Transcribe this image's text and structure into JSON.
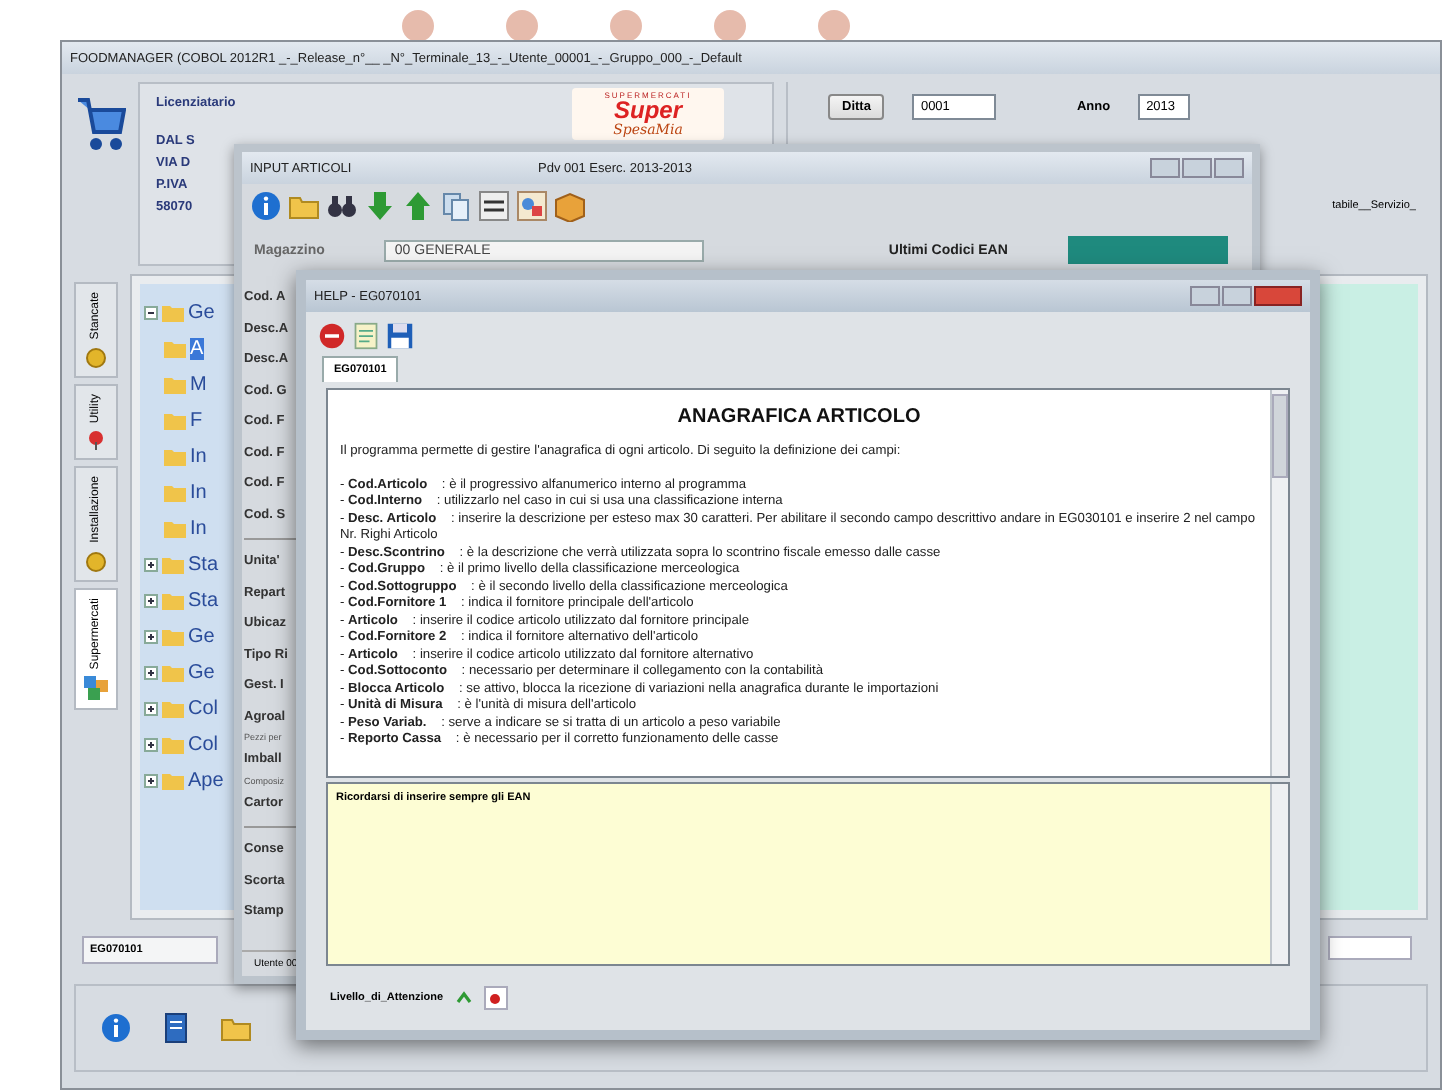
{
  "main_window": {
    "title": "FOODMANAGER (COBOL 2012R1 _-_Release_n°__ _N°_Terminale_13_-_Utente_00001_-_Gruppo_000_-_Default",
    "licensee": {
      "label": "Licenziatario",
      "lines": [
        "DAL S",
        "VIA D",
        "P.IVA",
        "58070"
      ]
    },
    "logo": {
      "tagline": "SUPERMERCATI",
      "word1": "Super",
      "word2": "SpesaMia"
    },
    "company_button": "Ditta",
    "company": "0001",
    "year_label": "Anno",
    "year": "2013",
    "right_label": "tabile__Servizio_",
    "side_tabs": [
      {
        "label": "Stancate",
        "selected": false
      },
      {
        "label": "Utility",
        "selected": false
      },
      {
        "label": "Installazione",
        "selected": false
      },
      {
        "label": "Supermercati",
        "selected": true
      }
    ],
    "tree": [
      {
        "label": "Ge",
        "expanded": true,
        "selected": false,
        "children": [
          {
            "label": "A",
            "selected": true
          },
          {
            "label": "M",
            "selected": false
          },
          {
            "label": "F",
            "selected": false
          },
          {
            "label": "In",
            "selected": false
          },
          {
            "label": "In",
            "selected": false
          },
          {
            "label": "In",
            "selected": false
          }
        ]
      },
      {
        "label": "Sta",
        "expanded": false,
        "selected": false
      },
      {
        "label": "Sta",
        "expanded": false,
        "selected": false
      },
      {
        "label": "Ge",
        "expanded": false,
        "selected": false
      },
      {
        "label": "Ge",
        "expanded": false,
        "selected": false
      },
      {
        "label": "Col",
        "expanded": false,
        "selected": false
      },
      {
        "label": "Col",
        "expanded": false,
        "selected": false
      },
      {
        "label": "Ape",
        "expanded": false,
        "selected": false
      }
    ],
    "program_code": "EG070101"
  },
  "input_window": {
    "title": "INPUT ARTICOLI",
    "info": "Pdv 001   Eserc. 2013-2013",
    "warehouse_label": "Magazzino",
    "warehouse": "00 GENERALE",
    "ean_label": "Ultimi Codici EAN",
    "field_groups": [
      [
        {
          "kind": "field",
          "label": "Cod. A"
        },
        {
          "kind": "field",
          "label": "Desc.A"
        },
        {
          "kind": "field",
          "label": "Desc.A"
        },
        {
          "kind": "field",
          "label": "Cod. G"
        },
        {
          "kind": "field",
          "label": "Cod. F"
        },
        {
          "kind": "field",
          "label": "Cod. F"
        },
        {
          "kind": "field",
          "label": "Cod. F"
        },
        {
          "kind": "field",
          "label": "Cod. S"
        }
      ],
      [
        {
          "kind": "field",
          "label": "Unita'"
        },
        {
          "kind": "field",
          "label": "Repart"
        },
        {
          "kind": "field",
          "label": "Ubicaz"
        },
        {
          "kind": "field",
          "label": "Tipo Ri"
        },
        {
          "kind": "field",
          "label": "Gest. I"
        },
        {
          "kind": "field",
          "label": "Agroal"
        },
        {
          "kind": "note",
          "label": "Pezzi per"
        },
        {
          "kind": "field",
          "label": "Imball"
        },
        {
          "kind": "note",
          "label": "Composiz"
        },
        {
          "kind": "field",
          "label": "Cartor"
        }
      ],
      [
        {
          "kind": "field",
          "label": "Conse"
        },
        {
          "kind": "field",
          "label": "Scorta"
        },
        {
          "kind": "field",
          "label": "Stamp"
        }
      ]
    ],
    "status": "Utente 00"
  },
  "help_window": {
    "title": "HELP - EG070101",
    "tabs": [
      {
        "label": "EG070101",
        "selected": true
      }
    ],
    "heading": "ANAGRAFICA ARTICOLO",
    "intro": "Il programma permette di gestire l'anagrafica di ogni articolo. Di seguito la definizione dei campi:",
    "items": [
      "- **Cod.Articolo**    : è il progressivo alfanumerico interno al programma",
      "- **Cod.Interno**    : utilizzarlo nel caso in cui si usa una classificazione interna",
      "- **Desc. Articolo**    : inserire la descrizione per esteso max 30 caratteri. Per abilitare il secondo campo descrittivo andare in EG030101 e inserire 2 nel campo Nr. Righi Articolo",
      "- **Desc.Scontrino**    : è la descrizione che verrà utilizzata sopra lo scontrino fiscale emesso dalle casse",
      "- **Cod.Gruppo**    : è il primo livello della classificazione merceologica",
      "- **Cod.Sottogruppo**    : è il secondo livello della classificazione merceologica",
      "- **Cod.Fornitore 1**    : indica il fornitore principale dell'articolo",
      "- **Articolo**    : inserire il codice articolo utilizzato dal fornitore principale",
      "- **Cod.Fornitore 2**    : indica il fornitore alternativo dell'articolo",
      "- **Articolo**    : inserire il codice articolo utilizzato dal fornitore alternativo",
      "- **Cod.Sottoconto**    : necessario per determinare il collegamento con la contabilità",
      "- **Blocca Articolo**    : se attivo, blocca la ricezione di variazioni nella anagrafica durante le importazioni",
      "- **Unità di Misura**    : è l'unità di misura dell'articolo",
      "- **Peso Variab.**    : serve a indicare se si tratta di un articolo a peso variabile",
      "- **Reporto Cassa**    : è necessario per il corretto funzionamento delle casse"
    ],
    "memo": "Ricordarsi di inserire sempre gli EAN",
    "attention_label": "Livello_di_Attenzione"
  }
}
